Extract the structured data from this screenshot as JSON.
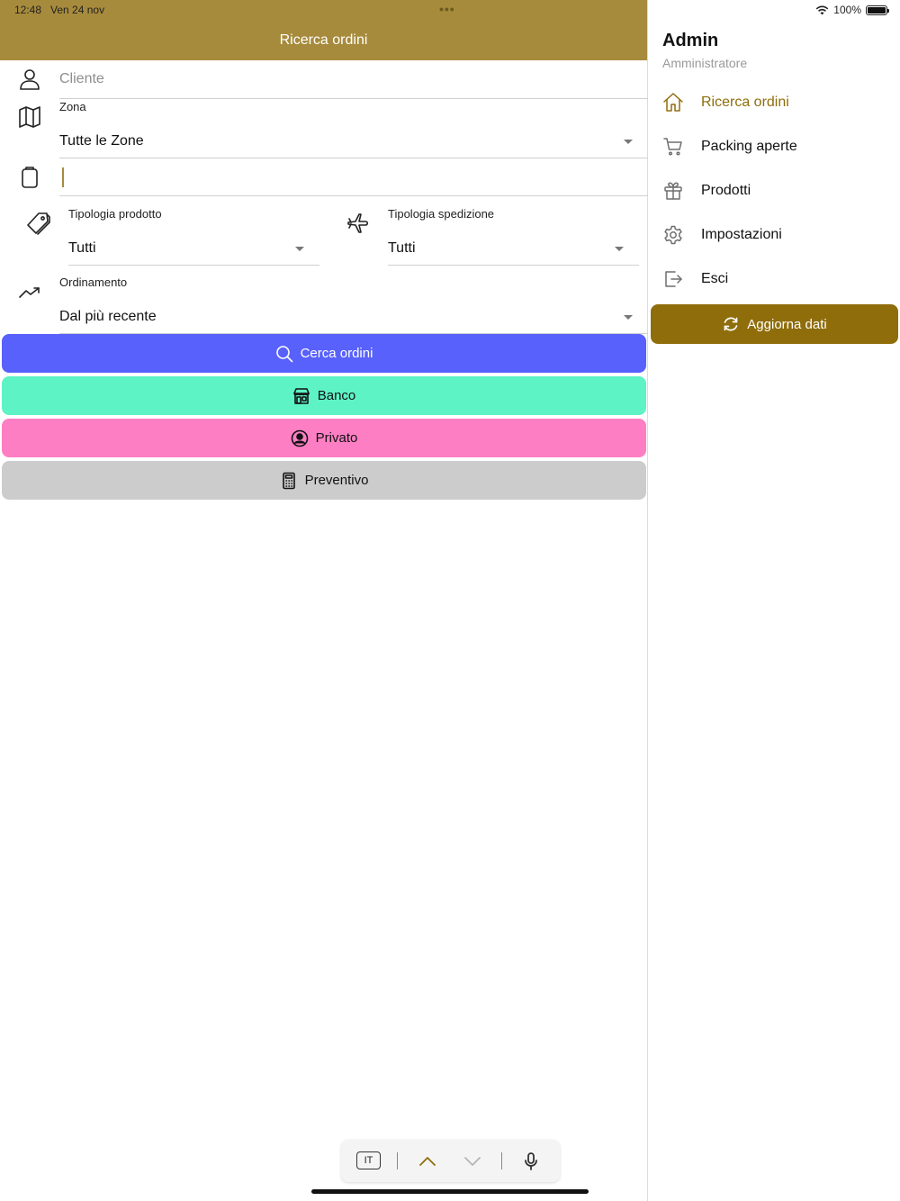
{
  "status": {
    "time": "12:48",
    "date": "Ven 24 nov",
    "dots": "•••",
    "battery": "100%",
    "battery_level": 1.0
  },
  "header": {
    "title": "Ricerca ordini"
  },
  "form": {
    "cliente": {
      "placeholder": "Cliente",
      "icon": "person-icon"
    },
    "zona": {
      "label": "Zona",
      "value": "Tutte le Zone",
      "icon": "map-icon"
    },
    "note": {
      "value": "",
      "icon": "clipboard-icon"
    },
    "tipologia_prodotto": {
      "label": "Tipologia prodotto",
      "value": "Tutti",
      "icon": "tag-icon"
    },
    "tipologia_spedizione": {
      "label": "Tipologia spedizione",
      "value": "Tutti",
      "icon": "airplane-icon"
    },
    "ordinamento": {
      "label": "Ordinamento",
      "value": "Dal più recente",
      "icon": "trending-up-icon"
    }
  },
  "buttons": {
    "cerca": {
      "label": "Cerca ordini",
      "color": "#5861fb"
    },
    "banco": {
      "label": "Banco",
      "color": "#5df3c5"
    },
    "privato": {
      "label": "Privato",
      "color": "#fe7ec4"
    },
    "preventivo": {
      "label": "Preventivo",
      "color": "#cccccc"
    }
  },
  "sidebar": {
    "name": "Admin",
    "role": "Amministratore",
    "items": [
      {
        "label": "Ricerca ordini",
        "icon": "home-icon",
        "active": true
      },
      {
        "label": "Packing aperte",
        "icon": "cart-icon",
        "active": false
      },
      {
        "label": "Prodotti",
        "icon": "gift-icon",
        "active": false
      },
      {
        "label": "Impostazioni",
        "icon": "gear-icon",
        "active": false
      },
      {
        "label": "Esci",
        "icon": "logout-icon",
        "active": false
      }
    ],
    "refresh_label": "Aggiorna dati",
    "accent": "#8f6d0b"
  },
  "keyboard_bar": {
    "lang": "IT"
  },
  "colors": {
    "header": "#a78b3c"
  }
}
